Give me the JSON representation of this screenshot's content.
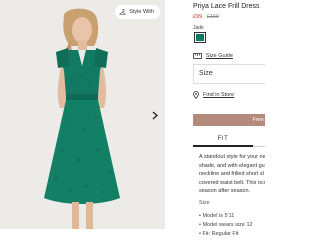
{
  "product": {
    "title": "Priya Lace Frill Dress",
    "price_now": "£99",
    "price_was": "£160",
    "colour": "Jade",
    "colour_hex": "#0f7a62"
  },
  "gallery": {
    "style_with_label": "Style With",
    "style_icon": "hanger-icon",
    "next_icon": "chevron-right-icon"
  },
  "actions": {
    "size_guide_label": "Size Guide",
    "size_label": "Size",
    "find_in_store_label": "Find in Store",
    "add_button_label": "Free Sta"
  },
  "tabs": {
    "fit_label": "FIT"
  },
  "description": {
    "text": "A standout style for your ne shade, and with elegant gui neckline and frilled short sl covered waist belt. This occ season after season.",
    "specs_heading": "Size",
    "specs": [
      "Model is 5'11",
      "Model wears size 12",
      "Fit: Regular Fit"
    ]
  }
}
